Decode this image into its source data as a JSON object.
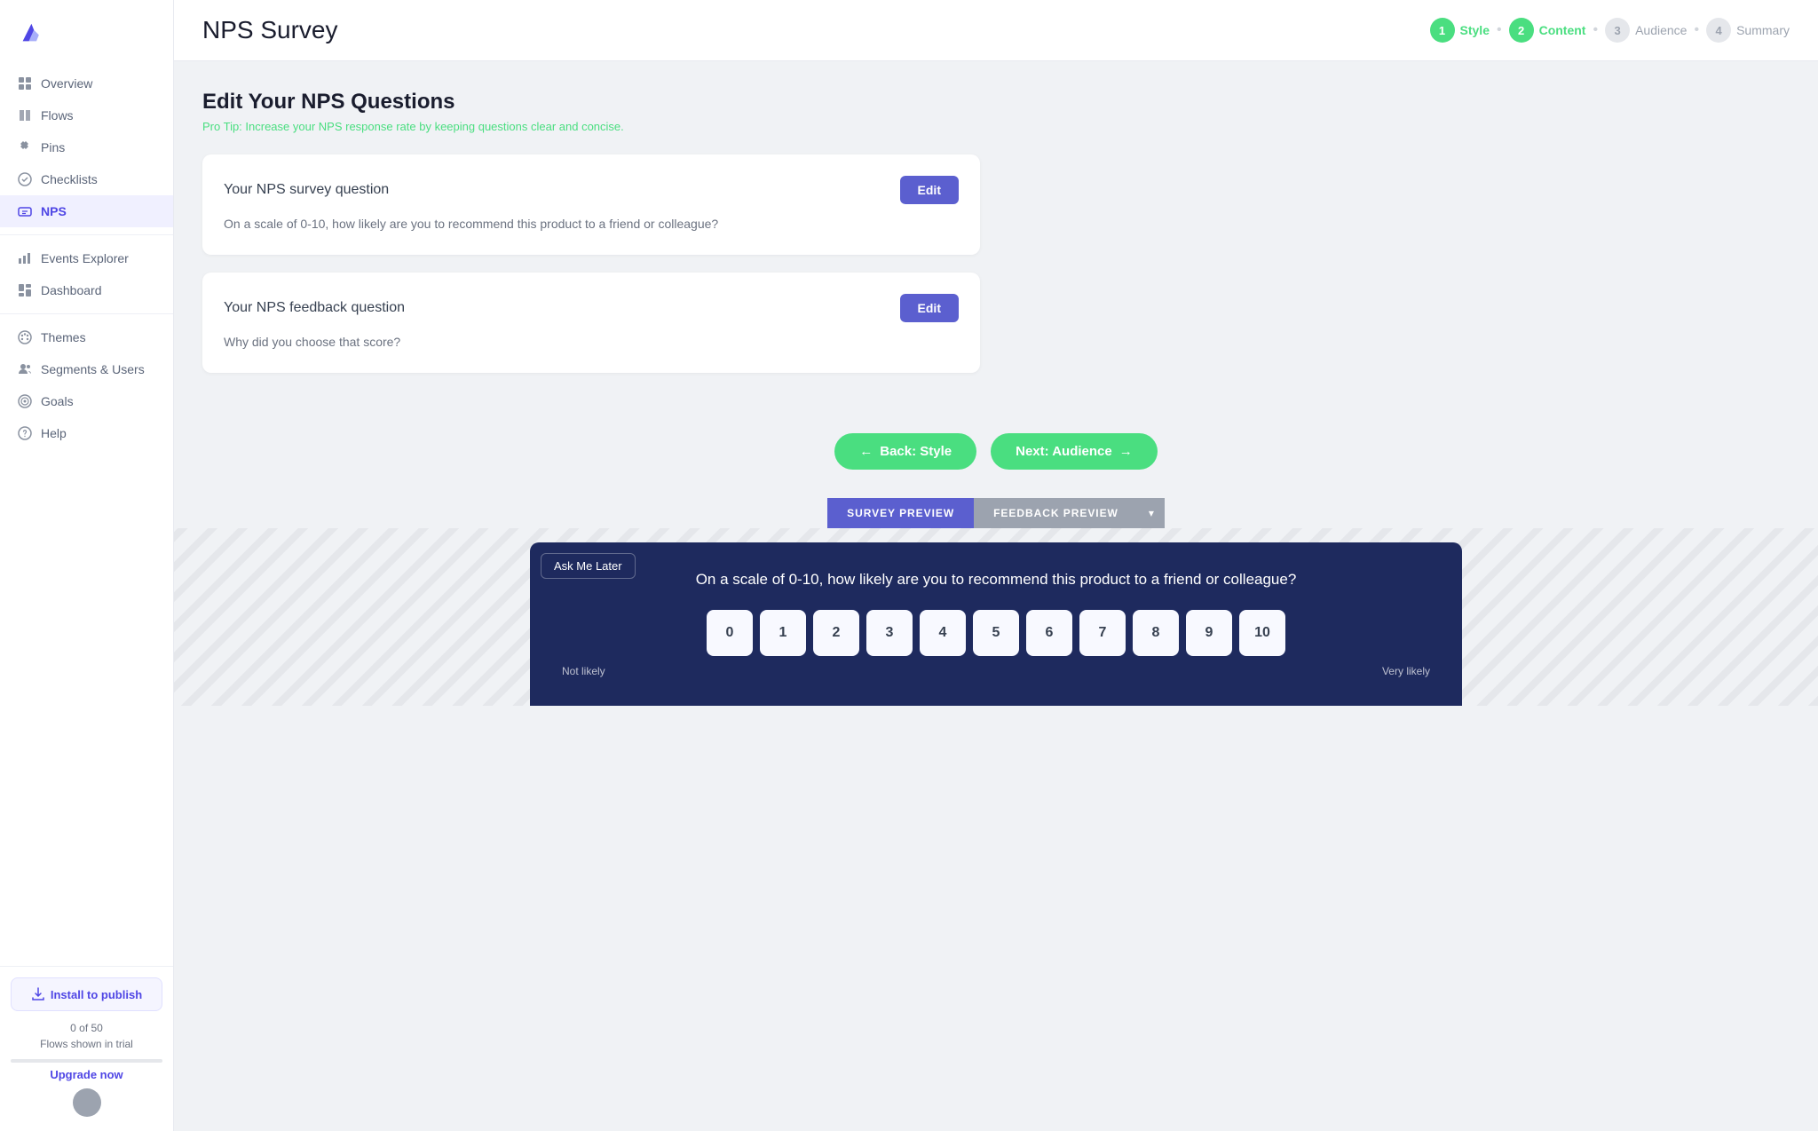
{
  "app": {
    "logo_alt": "Appcues logo"
  },
  "sidebar": {
    "nav_items": [
      {
        "id": "overview",
        "label": "Overview",
        "icon": "grid-icon"
      },
      {
        "id": "flows",
        "label": "Flows",
        "icon": "book-icon"
      },
      {
        "id": "pins",
        "label": "Pins",
        "icon": "pin-icon"
      },
      {
        "id": "checklists",
        "label": "Checklists",
        "icon": "checklist-icon"
      },
      {
        "id": "nps",
        "label": "NPS",
        "icon": "nps-icon",
        "active": true
      },
      {
        "id": "events-explorer",
        "label": "Events Explorer",
        "icon": "chart-icon"
      },
      {
        "id": "dashboard",
        "label": "Dashboard",
        "icon": "dashboard-icon"
      },
      {
        "id": "themes",
        "label": "Themes",
        "icon": "palette-icon"
      },
      {
        "id": "segments-users",
        "label": "Segments & Users",
        "icon": "users-icon"
      },
      {
        "id": "goals",
        "label": "Goals",
        "icon": "goals-icon"
      },
      {
        "id": "help",
        "label": "Help",
        "icon": "help-icon"
      }
    ],
    "install_btn_label": "Install to publish",
    "trial_flows": "0 of 50",
    "trial_label": "Flows shown in trial",
    "upgrade_label": "Upgrade now"
  },
  "page": {
    "title": "NPS Survey",
    "steps": [
      {
        "number": "1",
        "label": "Style",
        "state": "active"
      },
      {
        "number": "2",
        "label": "Content",
        "state": "current"
      },
      {
        "number": "3",
        "label": "Audience",
        "state": "inactive"
      },
      {
        "number": "4",
        "label": "Summary",
        "state": "inactive"
      }
    ]
  },
  "content": {
    "section_title": "Edit Your NPS Questions",
    "section_tip": "Pro Tip: Increase your NPS response rate by keeping questions clear and concise.",
    "question_cards": [
      {
        "title": "Your NPS survey question",
        "text": "On a scale of 0-10, how likely are you to recommend this product to a friend or colleague?",
        "edit_label": "Edit"
      },
      {
        "title": "Your NPS feedback question",
        "text": "Why did you choose that score?",
        "edit_label": "Edit"
      }
    ],
    "back_btn": "Back: Style",
    "next_btn": "Next: Audience"
  },
  "preview": {
    "tab_survey": "SURVEY PREVIEW",
    "tab_feedback": "FEEDBACK PREVIEW",
    "ask_later": "Ask Me Later",
    "nps_question": "On a scale of 0-10, how likely are you to recommend this product to a friend or colleague?",
    "nps_numbers": [
      "0",
      "1",
      "2",
      "3",
      "4",
      "5",
      "6",
      "7",
      "8",
      "9",
      "10"
    ],
    "label_not_likely": "Not likely",
    "label_very_likely": "Very likely"
  }
}
